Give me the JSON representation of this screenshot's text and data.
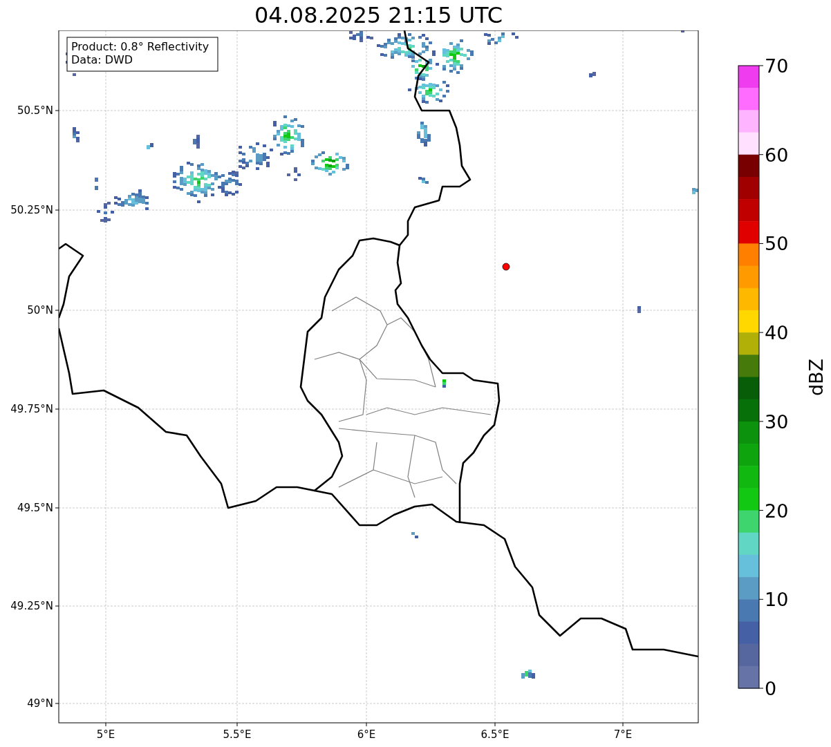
{
  "title": "04.08.2025 21:15 UTC",
  "map": {
    "legend": [
      "Product: 0.8° Reflectivity",
      "Data: DWD"
    ],
    "x_ticks": [
      "5°E",
      "5.5°E",
      "6°E",
      "6.5°E",
      "7°E"
    ],
    "y_ticks": [
      "50.5°N",
      "50.25°N",
      "50°N",
      "49.75°N",
      "49.5°N",
      "49.25°N",
      "49°N"
    ]
  },
  "colorbar": {
    "label": "dBZ",
    "ticks": [
      "70",
      "60",
      "50",
      "40",
      "30",
      "20",
      "10",
      "0"
    ],
    "bands": [
      {
        "color": "#ee3cee"
      },
      {
        "color": "#ff6cff"
      },
      {
        "color": "#ffb4ff"
      },
      {
        "color": "#ffe0ff"
      },
      {
        "color": "#780000"
      },
      {
        "color": "#a00000"
      },
      {
        "color": "#c00000"
      },
      {
        "color": "#e00000"
      },
      {
        "color": "#ff7f00"
      },
      {
        "color": "#ff9a00"
      },
      {
        "color": "#ffb800"
      },
      {
        "color": "#ffd800"
      },
      {
        "color": "#b0b008"
      },
      {
        "color": "#467a0a"
      },
      {
        "color": "#085e08"
      },
      {
        "color": "#087008"
      },
      {
        "color": "#0c920c"
      },
      {
        "color": "#0ea40e"
      },
      {
        "color": "#10b810"
      },
      {
        "color": "#12c812"
      },
      {
        "color": "#3ed46e"
      },
      {
        "color": "#62d6c4"
      },
      {
        "color": "#66c0dc"
      },
      {
        "color": "#5a9cc4"
      },
      {
        "color": "#4a78b0"
      },
      {
        "color": "#4660a6"
      },
      {
        "color": "#5667a0"
      },
      {
        "color": "#6673a6"
      }
    ]
  }
}
